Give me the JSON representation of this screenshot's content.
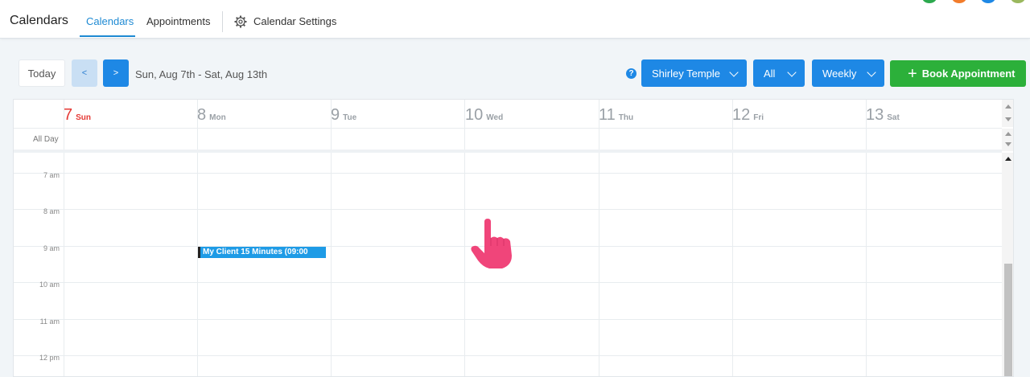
{
  "header": {
    "app_title": "Calendars",
    "tabs": [
      {
        "label": "Calendars",
        "active": true
      },
      {
        "label": "Appointments",
        "active": false
      },
      {
        "label": "Calendar Settings",
        "active": false
      }
    ]
  },
  "toolbar": {
    "today_label": "Today",
    "prev_label": "<",
    "next_label": ">",
    "date_range": "Sun, Aug 7th - Sat, Aug 13th",
    "help_label": "?",
    "user_dropdown": "Shirley Temple",
    "filter_dropdown": "All",
    "view_dropdown": "Weekly",
    "book_label": "Book Appointment"
  },
  "calendar": {
    "days": [
      {
        "num": "7",
        "name": "Sun",
        "today": true
      },
      {
        "num": "8",
        "name": "Mon",
        "today": false
      },
      {
        "num": "9",
        "name": "Tue",
        "today": false
      },
      {
        "num": "10",
        "name": "Wed",
        "today": false
      },
      {
        "num": "11",
        "name": "Thu",
        "today": false
      },
      {
        "num": "12",
        "name": "Fri",
        "today": false
      },
      {
        "num": "13",
        "name": "Sat",
        "today": false
      }
    ],
    "all_day_label": "All Day",
    "times": [
      "7 am",
      "8 am",
      "9 am",
      "10 am",
      "11 am",
      "12 pm"
    ],
    "event": {
      "title": "My Client 15 Minutes (09:00",
      "day": "Mon",
      "color": "#1e9be6"
    }
  },
  "colors": {
    "accent": "#1e88e5",
    "book_green": "#2cb03a",
    "today_red": "#e53935"
  },
  "icons": {
    "settings": "gear-icon",
    "help": "help-icon",
    "pointer": "pointing-hand-icon"
  }
}
